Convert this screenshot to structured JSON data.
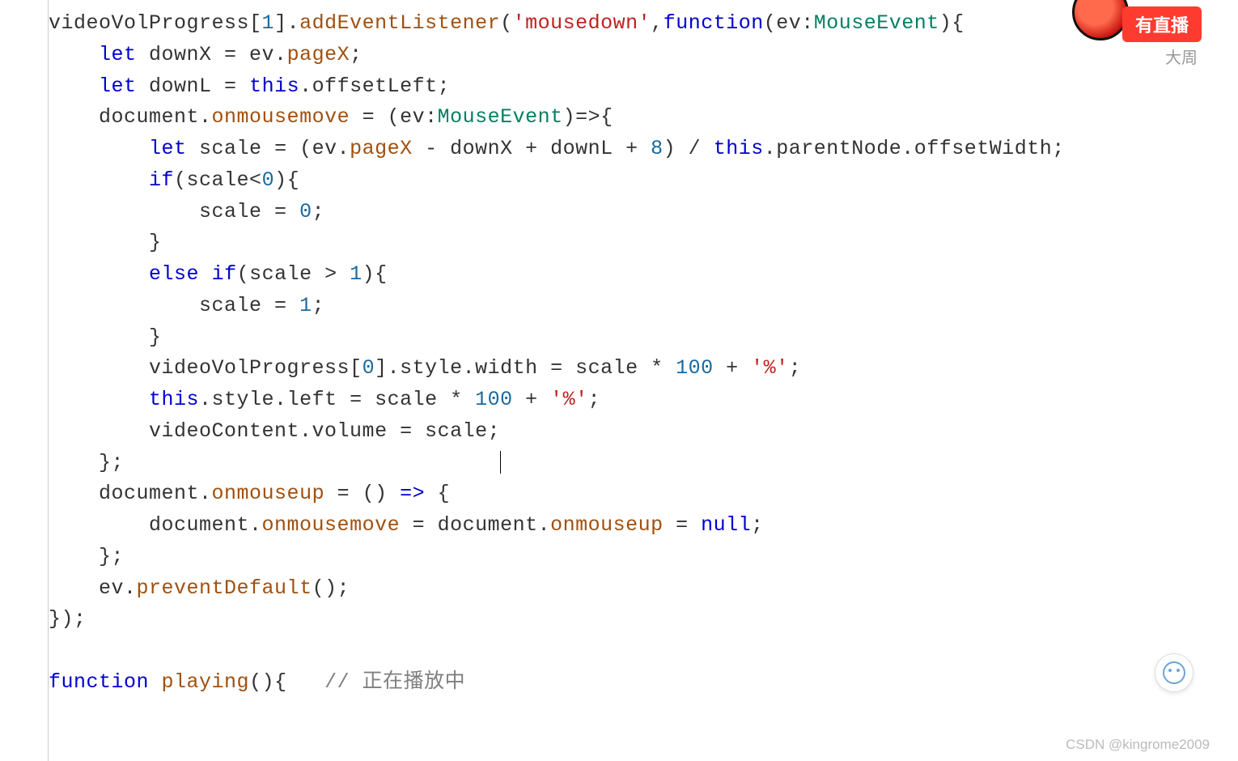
{
  "badge": {
    "live": "有直播"
  },
  "author": "大周",
  "watermark": "CSDN @kingrome2009",
  "code": {
    "l1a": "videoVolProgress[",
    "l1num": "1",
    "l1b": "].",
    "l1fn1": "addEventListener",
    "l1p1": "(",
    "l1str": "'mousedown'",
    "l1c": ",",
    "l1kw": "function",
    "l1p2": "(ev:",
    "l1type": "MouseEvent",
    "l1p3": "){",
    "l2a": "    ",
    "l2kw": "let",
    "l2b": " downX = ev.",
    "l2fn": "pageX",
    "l2c": ";",
    "l3a": "    ",
    "l3kw": "let",
    "l3b": " downL = ",
    "l3this": "this",
    "l3c": ".offsetLeft;",
    "l4a": "    document.",
    "l4fn": "onmousemove",
    "l4b": " = (ev:",
    "l4type": "MouseEvent",
    "l4c": ")=>{",
    "l5a": "        ",
    "l5kw": "let",
    "l5b": " scale = (ev.",
    "l5fn": "pageX",
    "l5c": " - downX + downL + ",
    "l5num": "8",
    "l5d": ") / ",
    "l5this": "this",
    "l5e": ".parentNode.offsetWidth;",
    "l6a": "        ",
    "l6kw": "if",
    "l6b": "(scale<",
    "l6num": "0",
    "l6c": "){",
    "l7a": "            scale = ",
    "l7num": "0",
    "l7b": ";",
    "l8": "        }",
    "l9a": "        ",
    "l9kw1": "else",
    "l9sp": " ",
    "l9kw2": "if",
    "l9b": "(scale > ",
    "l9num": "1",
    "l9c": "){",
    "l10a": "            scale = ",
    "l10num": "1",
    "l10b": ";",
    "l11": "        }",
    "l12a": "        videoVolProgress[",
    "l12num1": "0",
    "l12b": "].style.width = scale * ",
    "l12num2": "100",
    "l12c": " + ",
    "l12str": "'%'",
    "l12d": ";",
    "l13a": "        ",
    "l13this": "this",
    "l13b": ".style.left = scale * ",
    "l13num": "100",
    "l13c": " + ",
    "l13str": "'%'",
    "l13d": ";",
    "l14a": "        videoContent.volume = scale;",
    "l15": "    };",
    "l16a": "    document.",
    "l16fn": "onmouseup",
    "l16b": " = () ",
    "l16arrow": "=>",
    "l16c": " {",
    "l17a": "        document.",
    "l17fn1": "onmousemove",
    "l17b": " = document.",
    "l17fn2": "onmouseup",
    "l17c": " = ",
    "l17null": "null",
    "l17d": ";",
    "l18": "    };",
    "l19a": "    ev.",
    "l19fn": "preventDefault",
    "l19b": "();",
    "l20": "});",
    "l21": "",
    "l22kw": "function",
    "l22b": " ",
    "l22fn": "playing",
    "l22c": "(){   ",
    "l22cm": "// 正在播放中"
  }
}
